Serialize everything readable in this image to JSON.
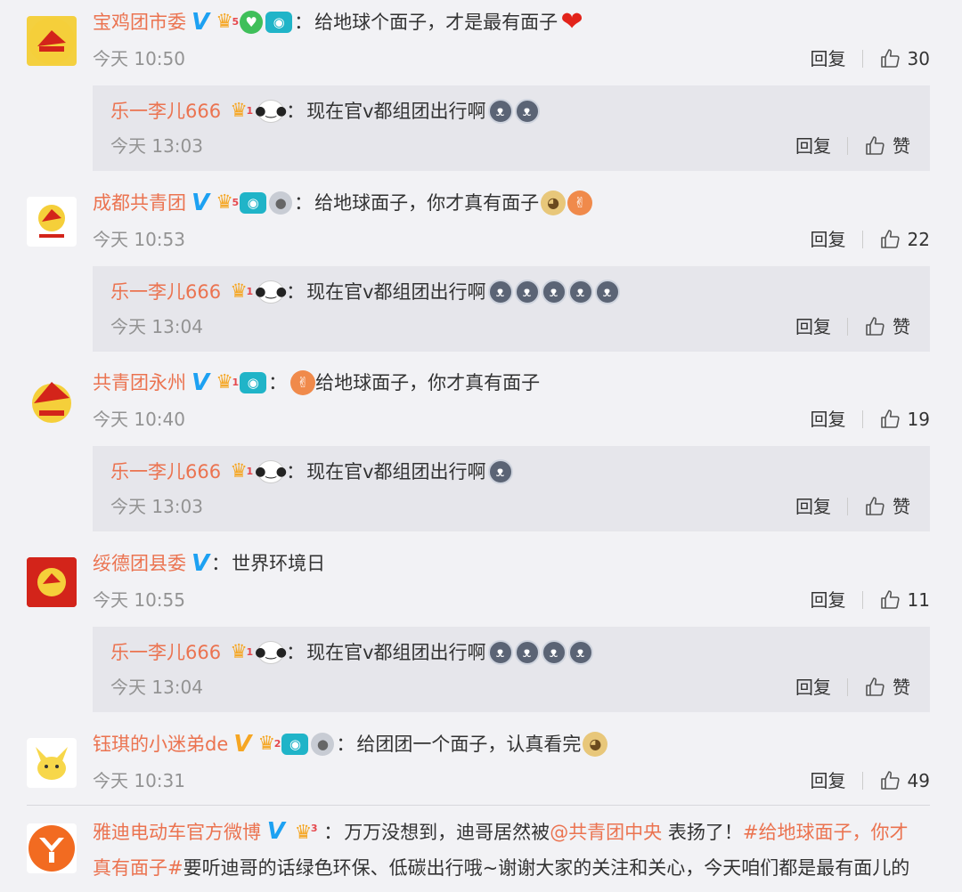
{
  "comments": [
    {
      "name": "宝鸡团市委",
      "crown_level": "5",
      "text": "给地球个面子，才是最有面子",
      "time": "今天 10:50",
      "reply": "回复",
      "likes": "30",
      "sub": {
        "name": "乐一李儿666",
        "crown_level": "1",
        "text": "现在官v都组团出行啊",
        "time": "今天 13:03",
        "reply": "回复",
        "like_label": "赞"
      }
    },
    {
      "name": "成都共青团",
      "crown_level": "5",
      "text": "给地球面子，你才真有面子",
      "time": "今天 10:53",
      "reply": "回复",
      "likes": "22",
      "sub": {
        "name": "乐一李儿666",
        "crown_level": "1",
        "text": "现在官v都组团出行啊",
        "time": "今天 13:04",
        "reply": "回复",
        "like_label": "赞"
      }
    },
    {
      "name": "共青团永州",
      "crown_level": "1",
      "text": "给地球面子，你才真有面子",
      "time": "今天 10:40",
      "reply": "回复",
      "likes": "19",
      "sub": {
        "name": "乐一李儿666",
        "crown_level": "1",
        "text": "现在官v都组团出行啊",
        "time": "今天 13:03",
        "reply": "回复",
        "like_label": "赞"
      }
    },
    {
      "name": "绥德团县委",
      "text": "世界环境日",
      "time": "今天 10:55",
      "reply": "回复",
      "likes": "11",
      "sub": {
        "name": "乐一李儿666",
        "crown_level": "1",
        "text": "现在官v都组团出行啊",
        "time": "今天 13:04",
        "reply": "回复",
        "like_label": "赞"
      }
    },
    {
      "name": "钰琪的小迷弟de",
      "crown_level": "2",
      "text": "给团团一个面子，认真看完",
      "time": "今天 10:31",
      "reply": "回复",
      "likes": "49"
    }
  ],
  "last": {
    "name": "雅迪电动车官方微博",
    "crown_level": "3",
    "text_a": "万万没想到，迪哥居然被",
    "mention": "@共青团中央",
    "text_b": " 表扬了！",
    "topic_a": "#给地球面子，你才",
    "topic_b": "真有面子#",
    "text_c": "要听迪哥的话绿色环保、低碳出行哦~谢谢大家的关注和关心，今天咱们都是最有面儿的"
  },
  "colors": {
    "name_orange": "#eb7350",
    "verified_blue": "#1da1f2",
    "background": "#f2f2f5",
    "sub_background": "#e6e6eb"
  },
  "icons": [
    "verified-v-icon",
    "crown-icon",
    "camera-icon",
    "heart-badge-icon",
    "medal-icon",
    "panda-icon",
    "thumb-up-icon",
    "husky-emoji",
    "doge-emoji",
    "hands-emoji",
    "heart-emoji"
  ]
}
